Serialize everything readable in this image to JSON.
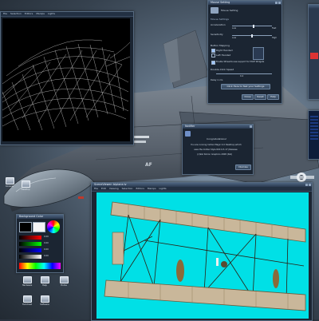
{
  "wireframe_window": {
    "menu": [
      "File",
      "Selection",
      "Editors",
      "Manips",
      "Lights"
    ]
  },
  "mouse_settings": {
    "title": "Mouse Setting",
    "subtitle": "Mouse Setting",
    "section_motion": "Mouse Settings",
    "acceleration_label": "Acceleration",
    "acceleration_low": "Low",
    "acceleration_high": "Fast",
    "acceleration_value": 0.55,
    "sensitivity_label": "Sensitivity",
    "sensitivity_low": "Low",
    "sensitivity_high": "High",
    "sensitivity_value": 0.5,
    "button_mapping_label": "Button Mapping",
    "right_handed": "Right Handed",
    "left_handed": "Left Handed",
    "wheelmouse_label": "Enable Wheelmouse support for Motif Widgets",
    "double_click_label": "Double-Click Speed",
    "double_click_value": "0.4",
    "delay_label": "Delay in ms",
    "test_button": "Click Here to Test your Settings",
    "btn_close": "Close",
    "btn_reset": "Reset",
    "btn_help": "Help"
  },
  "notifier": {
    "title": "Notifier",
    "line1": "Congratulations!",
    "line2": "You are running IndiGo Magic 4.0 Desktop (which",
    "line3": "uses the IndiGo Style IRIX 6.5.17) Release",
    "line4": "(c)SGI Silicon Graphics 2008 (SGI)",
    "dismiss": "Dismiss"
  },
  "background_color": {
    "title": "Background Color",
    "values": [
      "0.00",
      "0.00",
      "0.00",
      "0.00"
    ]
  },
  "viewer_window": {
    "title": "SceneViewer: biplane.iv",
    "menu": [
      "File",
      "Edit",
      "Viewing",
      "Selection",
      "Editors",
      "Manips",
      "Lights"
    ],
    "background_color": "#00e0e6"
  },
  "desktop_icons": [
    {
      "label": "Console"
    },
    {
      "label": "Desktop"
    },
    {
      "label": "Hardware"
    },
    {
      "label": "Help"
    },
    {
      "label": "Home"
    },
    {
      "label": "Software"
    },
    {
      "label": "Toolchest"
    }
  ]
}
